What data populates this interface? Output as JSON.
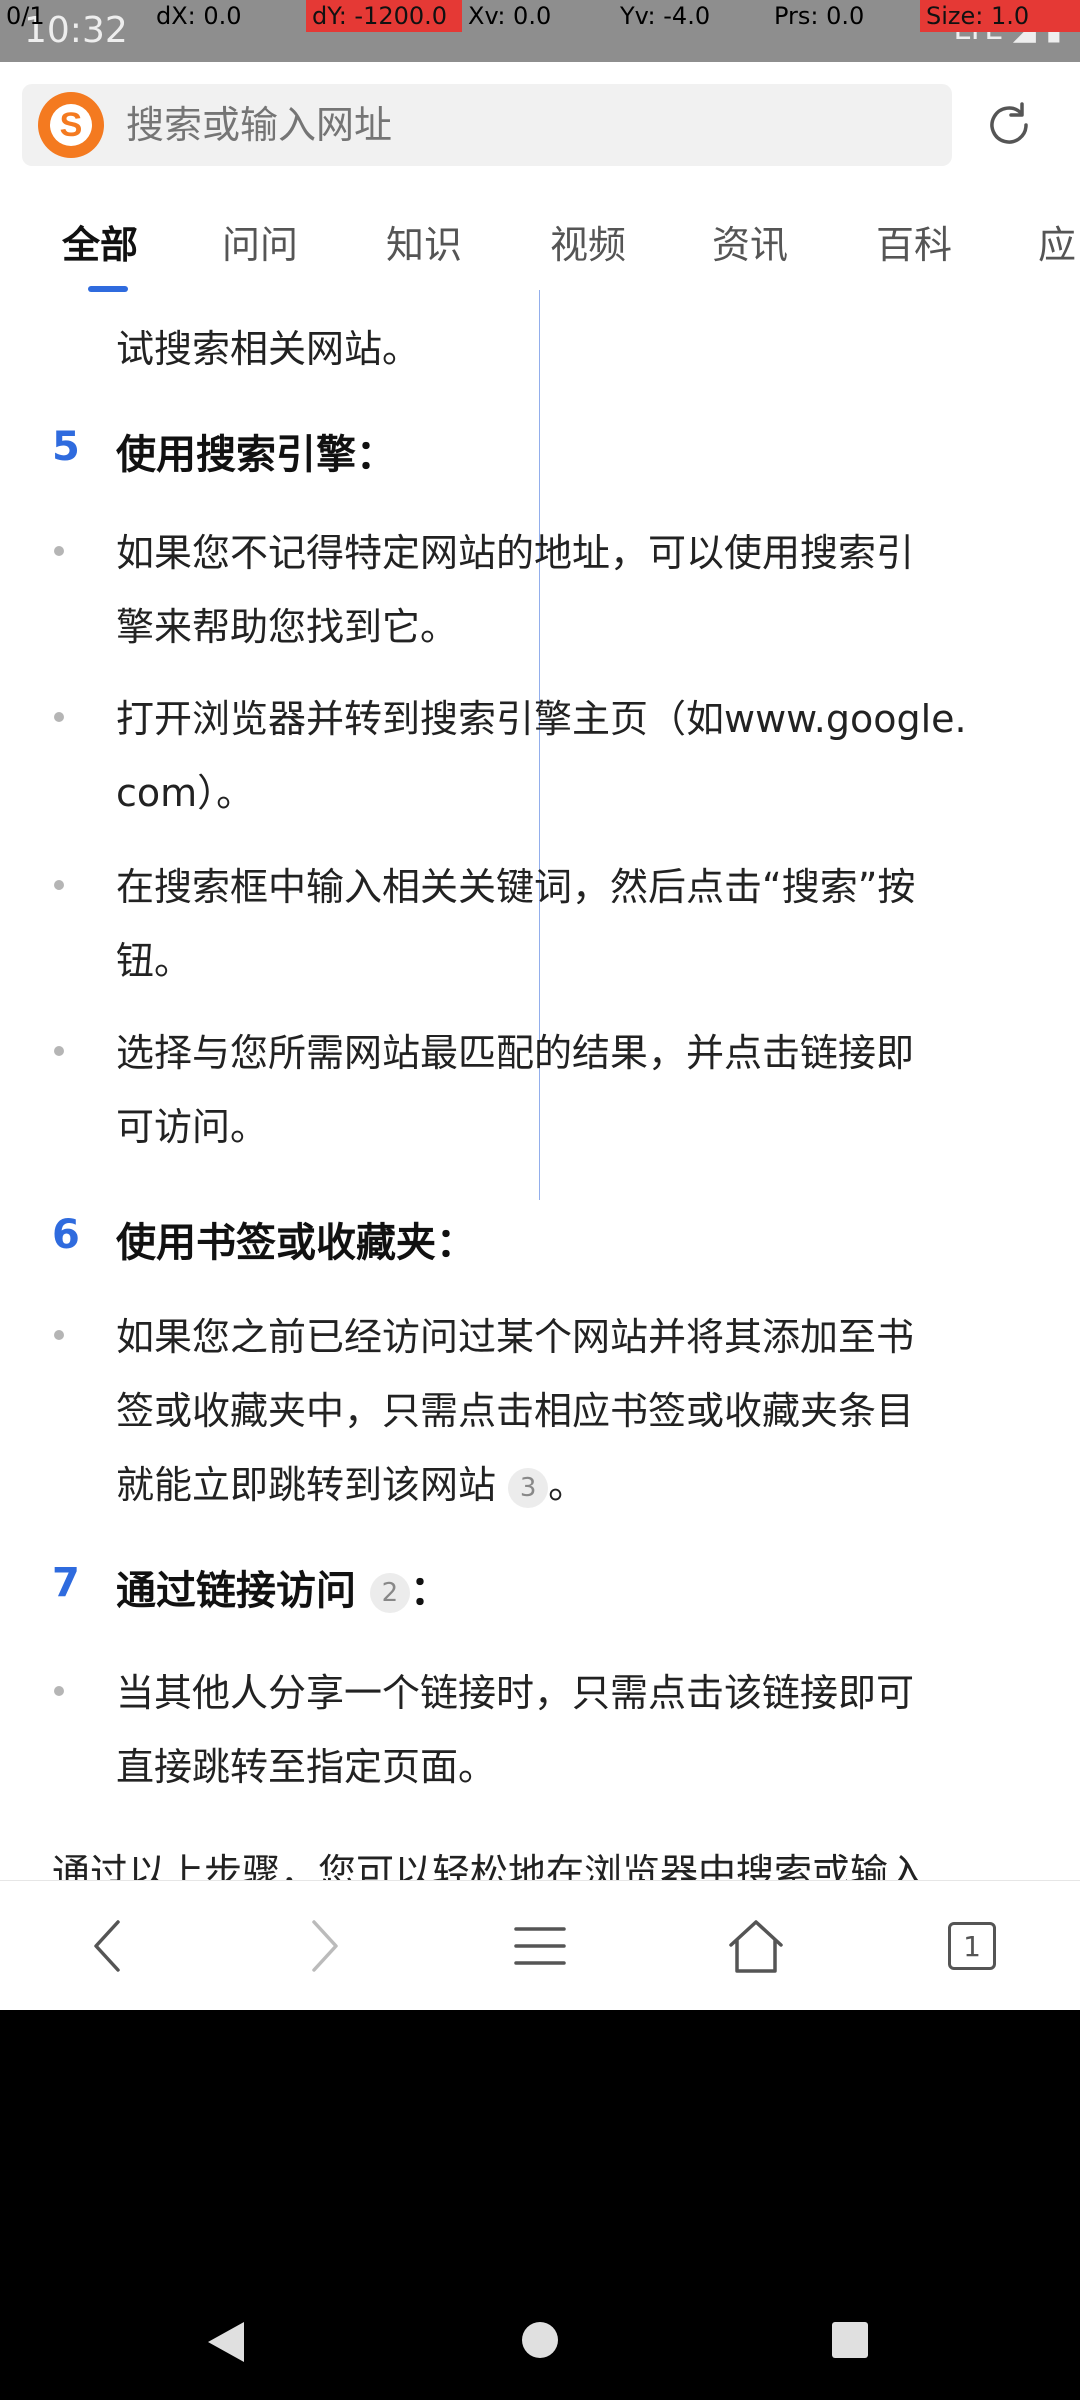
{
  "status_bar": {
    "time": "10:32",
    "signal_text": "LTE",
    "debug": [
      "0/1",
      "dX: 0.0",
      "dY: -1200.0",
      "Xv: 0.0",
      "Yv: -4.0",
      "Prs: 0.0",
      "Size: 1.0"
    ]
  },
  "address_bar": {
    "logo_letter": "S",
    "placeholder": "搜索或输入网址"
  },
  "tabs": [
    "全部",
    "问问",
    "知识",
    "视频",
    "资讯",
    "百科",
    "应"
  ],
  "content": {
    "line_top": "试搜索相关网站。",
    "step5": {
      "num": "5",
      "title": "使用搜索引擎："
    },
    "step5_bullet1": [
      "如果您不记得特定网站的地址，可以使用搜索引",
      "擎来帮助您找到它。"
    ],
    "step5_bullet2": [
      "打开浏览器并转到搜索引擎主页（如www.google.",
      "com）。"
    ],
    "step5_bullet3": [
      "在搜索框中输入相关关键词，然后点击“搜索”按",
      "钮。"
    ],
    "step5_bullet4": [
      "选择与您所需网站最匹配的结果，并点击链接即",
      "可访问。"
    ],
    "step6": {
      "num": "6",
      "title": "使用书签或收藏夹："
    },
    "step6_bullet1": [
      "如果您之前已经访问过某个网站并将其添加至书",
      "签或收藏夹中，只需点击相应书签或收藏夹条目",
      "就能立即跳转到该网站",
      "。"
    ],
    "step6_cite": "3",
    "step7": {
      "num": "7",
      "title": "通过链接访问",
      "colon": "："
    },
    "step7_cite": "2",
    "step7_bullet1": [
      "当其他人分享一个链接时，只需点击该链接即可",
      "直接跳转至指定页面。"
    ],
    "line_bottom": "通过以上步骤，您可以轻松地在浏览器中搜索或输入"
  },
  "bottom_nav": {
    "tab_count": "1"
  }
}
